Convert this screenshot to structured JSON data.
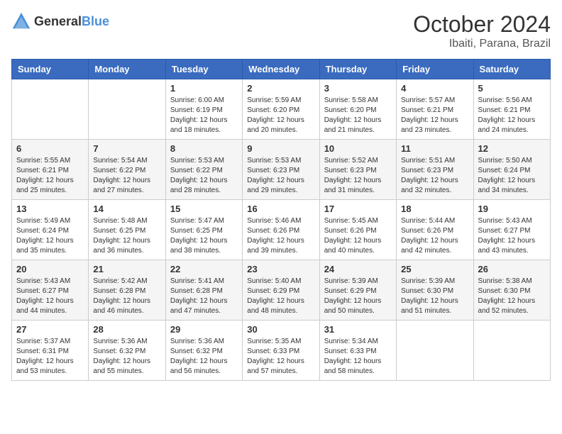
{
  "logo": {
    "general": "General",
    "blue": "Blue"
  },
  "header": {
    "month": "October 2024",
    "location": "Ibaiti, Parana, Brazil"
  },
  "weekdays": [
    "Sunday",
    "Monday",
    "Tuesday",
    "Wednesday",
    "Thursday",
    "Friday",
    "Saturday"
  ],
  "weeks": [
    [
      {
        "day": "",
        "info": ""
      },
      {
        "day": "",
        "info": ""
      },
      {
        "day": "1",
        "info": "Sunrise: 6:00 AM\nSunset: 6:19 PM\nDaylight: 12 hours and 18 minutes."
      },
      {
        "day": "2",
        "info": "Sunrise: 5:59 AM\nSunset: 6:20 PM\nDaylight: 12 hours and 20 minutes."
      },
      {
        "day": "3",
        "info": "Sunrise: 5:58 AM\nSunset: 6:20 PM\nDaylight: 12 hours and 21 minutes."
      },
      {
        "day": "4",
        "info": "Sunrise: 5:57 AM\nSunset: 6:21 PM\nDaylight: 12 hours and 23 minutes."
      },
      {
        "day": "5",
        "info": "Sunrise: 5:56 AM\nSunset: 6:21 PM\nDaylight: 12 hours and 24 minutes."
      }
    ],
    [
      {
        "day": "6",
        "info": "Sunrise: 5:55 AM\nSunset: 6:21 PM\nDaylight: 12 hours and 25 minutes."
      },
      {
        "day": "7",
        "info": "Sunrise: 5:54 AM\nSunset: 6:22 PM\nDaylight: 12 hours and 27 minutes."
      },
      {
        "day": "8",
        "info": "Sunrise: 5:53 AM\nSunset: 6:22 PM\nDaylight: 12 hours and 28 minutes."
      },
      {
        "day": "9",
        "info": "Sunrise: 5:53 AM\nSunset: 6:23 PM\nDaylight: 12 hours and 29 minutes."
      },
      {
        "day": "10",
        "info": "Sunrise: 5:52 AM\nSunset: 6:23 PM\nDaylight: 12 hours and 31 minutes."
      },
      {
        "day": "11",
        "info": "Sunrise: 5:51 AM\nSunset: 6:23 PM\nDaylight: 12 hours and 32 minutes."
      },
      {
        "day": "12",
        "info": "Sunrise: 5:50 AM\nSunset: 6:24 PM\nDaylight: 12 hours and 34 minutes."
      }
    ],
    [
      {
        "day": "13",
        "info": "Sunrise: 5:49 AM\nSunset: 6:24 PM\nDaylight: 12 hours and 35 minutes."
      },
      {
        "day": "14",
        "info": "Sunrise: 5:48 AM\nSunset: 6:25 PM\nDaylight: 12 hours and 36 minutes."
      },
      {
        "day": "15",
        "info": "Sunrise: 5:47 AM\nSunset: 6:25 PM\nDaylight: 12 hours and 38 minutes."
      },
      {
        "day": "16",
        "info": "Sunrise: 5:46 AM\nSunset: 6:26 PM\nDaylight: 12 hours and 39 minutes."
      },
      {
        "day": "17",
        "info": "Sunrise: 5:45 AM\nSunset: 6:26 PM\nDaylight: 12 hours and 40 minutes."
      },
      {
        "day": "18",
        "info": "Sunrise: 5:44 AM\nSunset: 6:26 PM\nDaylight: 12 hours and 42 minutes."
      },
      {
        "day": "19",
        "info": "Sunrise: 5:43 AM\nSunset: 6:27 PM\nDaylight: 12 hours and 43 minutes."
      }
    ],
    [
      {
        "day": "20",
        "info": "Sunrise: 5:43 AM\nSunset: 6:27 PM\nDaylight: 12 hours and 44 minutes."
      },
      {
        "day": "21",
        "info": "Sunrise: 5:42 AM\nSunset: 6:28 PM\nDaylight: 12 hours and 46 minutes."
      },
      {
        "day": "22",
        "info": "Sunrise: 5:41 AM\nSunset: 6:28 PM\nDaylight: 12 hours and 47 minutes."
      },
      {
        "day": "23",
        "info": "Sunrise: 5:40 AM\nSunset: 6:29 PM\nDaylight: 12 hours and 48 minutes."
      },
      {
        "day": "24",
        "info": "Sunrise: 5:39 AM\nSunset: 6:29 PM\nDaylight: 12 hours and 50 minutes."
      },
      {
        "day": "25",
        "info": "Sunrise: 5:39 AM\nSunset: 6:30 PM\nDaylight: 12 hours and 51 minutes."
      },
      {
        "day": "26",
        "info": "Sunrise: 5:38 AM\nSunset: 6:30 PM\nDaylight: 12 hours and 52 minutes."
      }
    ],
    [
      {
        "day": "27",
        "info": "Sunrise: 5:37 AM\nSunset: 6:31 PM\nDaylight: 12 hours and 53 minutes."
      },
      {
        "day": "28",
        "info": "Sunrise: 5:36 AM\nSunset: 6:32 PM\nDaylight: 12 hours and 55 minutes."
      },
      {
        "day": "29",
        "info": "Sunrise: 5:36 AM\nSunset: 6:32 PM\nDaylight: 12 hours and 56 minutes."
      },
      {
        "day": "30",
        "info": "Sunrise: 5:35 AM\nSunset: 6:33 PM\nDaylight: 12 hours and 57 minutes."
      },
      {
        "day": "31",
        "info": "Sunrise: 5:34 AM\nSunset: 6:33 PM\nDaylight: 12 hours and 58 minutes."
      },
      {
        "day": "",
        "info": ""
      },
      {
        "day": "",
        "info": ""
      }
    ]
  ]
}
